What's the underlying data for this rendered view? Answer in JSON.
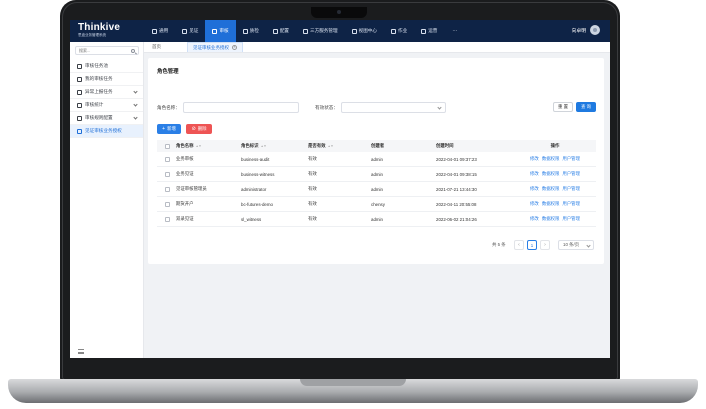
{
  "brand": {
    "name": "Thinkive",
    "subtitle": "思迪业务管理系统"
  },
  "topnav": {
    "items": [
      {
        "label": "通用",
        "active": false
      },
      {
        "label": "见证",
        "active": false
      },
      {
        "label": "审核",
        "active": true
      },
      {
        "label": "质检",
        "active": false
      },
      {
        "label": "配置",
        "active": false
      },
      {
        "label": "三方服务管理",
        "active": false
      },
      {
        "label": "视图中心",
        "active": false
      },
      {
        "label": "作业",
        "active": false
      },
      {
        "label": "运营",
        "active": false
      }
    ],
    "more_label": "···",
    "user_name": "向卓明"
  },
  "sidebar": {
    "search_placeholder": "搜索...",
    "items": [
      {
        "label": "审核任务池",
        "has_children": false,
        "active": false
      },
      {
        "label": "我的审核任务",
        "has_children": false,
        "active": false
      },
      {
        "label": "异常上报任务",
        "has_children": true,
        "active": false
      },
      {
        "label": "审核统计",
        "has_children": true,
        "active": false
      },
      {
        "label": "审核规则配置",
        "has_children": true,
        "active": false
      },
      {
        "label": "见证审核业务授权",
        "has_children": false,
        "active": true
      }
    ]
  },
  "tabs": {
    "home": "首页",
    "current": "见证审核业务授权",
    "close_glyph": "×"
  },
  "page": {
    "title": "角色管理",
    "filters": {
      "role_name_label": "角色名称：",
      "role_name_value": "",
      "status_label": "有效状态：",
      "status_value": ""
    },
    "buttons": {
      "reset": "重 置",
      "search": "查 询",
      "add": "新增",
      "delete": "删除"
    }
  },
  "table": {
    "columns": [
      "角色名称",
      "角色标识",
      "是否有效",
      "创建者",
      "创建时间",
      "操作"
    ],
    "rows": [
      {
        "name": "业务审核",
        "id": "business-audit",
        "valid": "有效",
        "creator": "admin",
        "time": "2022-04-01 09:37:23"
      },
      {
        "name": "业务见证",
        "id": "business-witness",
        "valid": "有效",
        "creator": "admin",
        "time": "2022-04-01 09:38:15"
      },
      {
        "name": "见证审核管理员",
        "id": "administrator",
        "valid": "有效",
        "creator": "admin",
        "time": "2021-07-21 13:44:30"
      },
      {
        "name": "期货开户",
        "id": "bc-futures-demo",
        "valid": "有效",
        "creator": "chensy",
        "time": "2022-04-11 20:55:08"
      },
      {
        "name": "双录见证",
        "id": "sl_witness",
        "valid": "有效",
        "creator": "admin",
        "time": "2022-06-02 21:04:26"
      }
    ],
    "ops": {
      "edit": "修改",
      "data_perm": "数据权限",
      "user_mgmt": "用户管理"
    }
  },
  "pagination": {
    "total": "共 5 条",
    "prev": "‹",
    "page": "1",
    "next": "›",
    "page_size": "10 条/页"
  }
}
